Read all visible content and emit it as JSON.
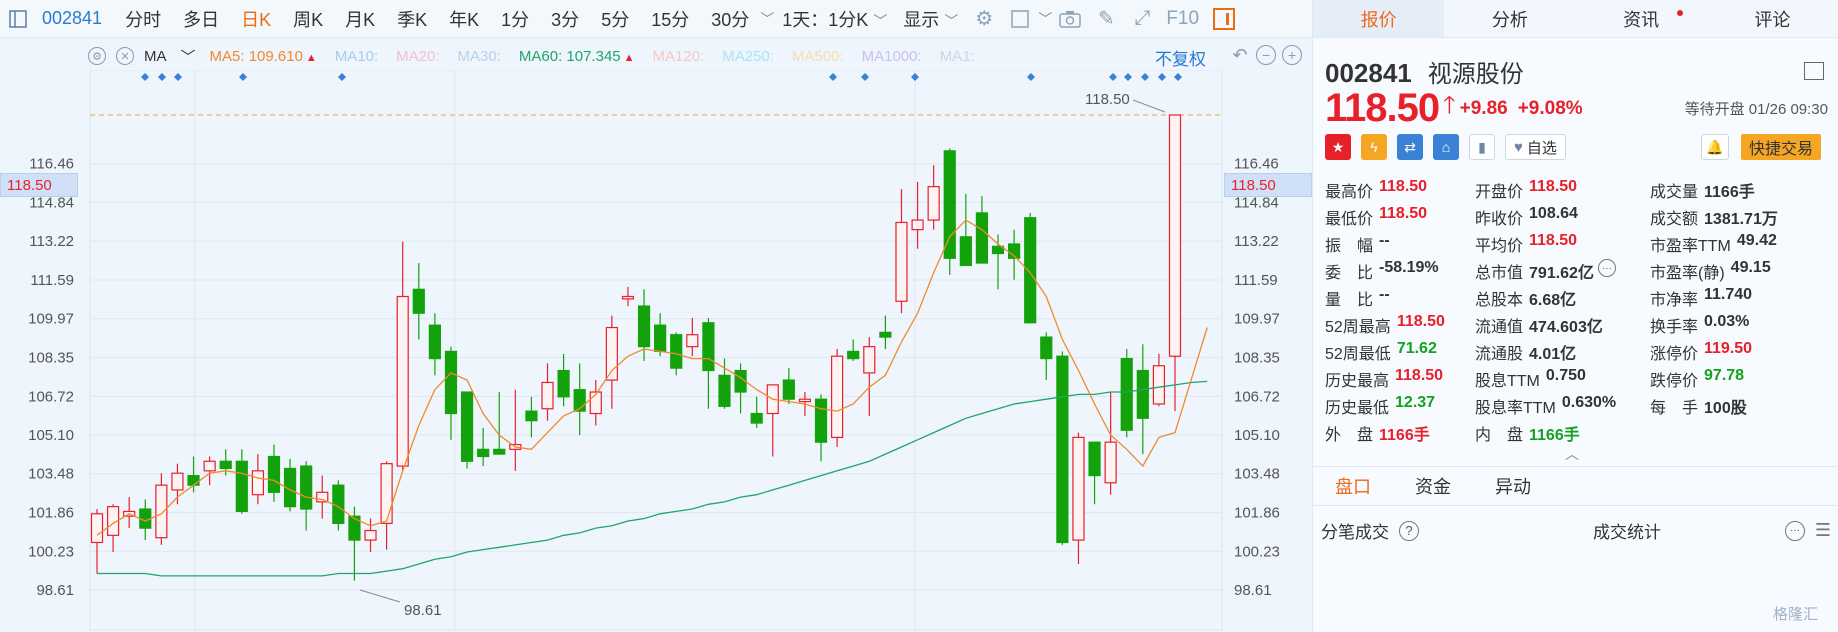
{
  "toolbar": {
    "stock_code": "002841",
    "periods": [
      "分时",
      "多日",
      "日K",
      "周K",
      "月K",
      "季K",
      "年K",
      "1分",
      "3分",
      "5分",
      "15分",
      "30分"
    ],
    "active_period": "日K",
    "range_select": "1天：1分K",
    "display_select": "显示",
    "f10_label": "F10"
  },
  "ma_bar": {
    "selector": "MA",
    "items": [
      {
        "label": "MA5: 109.610",
        "color": "#f08a2c",
        "arrow": true
      },
      {
        "label": "MA10:",
        "color": "#a9cde9"
      },
      {
        "label": "MA20:",
        "color": "#f2bfd6"
      },
      {
        "label": "MA30:",
        "color": "#b9d2ea"
      },
      {
        "label": "MA60: 107.345",
        "color": "#21a56b",
        "arrow": true
      },
      {
        "label": "MA120:",
        "color": "#f7c9c4"
      },
      {
        "label": "MA250:",
        "color": "#a8e6f3"
      },
      {
        "label": "MA500:",
        "color": "#f8dcb0"
      },
      {
        "label": "MA1000:",
        "color": "#c9c2ea"
      },
      {
        "label": "MA1:",
        "color": "#c9d6e4"
      }
    ],
    "adjust_label": "不复权"
  },
  "chart_data": {
    "type": "candlestick",
    "yticks": [
      "116.46",
      "114.84",
      "113.22",
      "111.59",
      "109.97",
      "108.35",
      "106.72",
      "105.10",
      "103.48",
      "101.86",
      "100.23",
      "98.61"
    ],
    "ylim": [
      98.61,
      118.5
    ],
    "current_price_label": "118.50",
    "high_label": "118.50",
    "low_label": "98.61",
    "up_color": "#e8202a",
    "down_color": "#13a20c",
    "ma5_color": "#f08a2c",
    "ma60_color": "#21a56b",
    "candles": [
      {
        "o": 100.6,
        "h": 102.0,
        "l": 99.3,
        "c": 101.8
      },
      {
        "o": 100.9,
        "h": 102.2,
        "l": 100.2,
        "c": 102.1
      },
      {
        "o": 101.7,
        "h": 102.5,
        "l": 101.2,
        "c": 101.9
      },
      {
        "o": 102.0,
        "h": 102.4,
        "l": 100.7,
        "c": 101.2
      },
      {
        "o": 100.8,
        "h": 103.5,
        "l": 100.5,
        "c": 103.0
      },
      {
        "o": 102.8,
        "h": 103.9,
        "l": 102.2,
        "c": 103.5
      },
      {
        "o": 103.4,
        "h": 104.2,
        "l": 102.7,
        "c": 103.0
      },
      {
        "o": 103.6,
        "h": 104.2,
        "l": 103.0,
        "c": 104.0
      },
      {
        "o": 104.0,
        "h": 104.5,
        "l": 103.4,
        "c": 103.7
      },
      {
        "o": 104.0,
        "h": 104.5,
        "l": 101.8,
        "c": 101.9
      },
      {
        "o": 102.6,
        "h": 104.3,
        "l": 102.2,
        "c": 103.6
      },
      {
        "o": 104.2,
        "h": 104.7,
        "l": 102.3,
        "c": 102.7
      },
      {
        "o": 103.7,
        "h": 104.1,
        "l": 101.9,
        "c": 102.1
      },
      {
        "o": 103.8,
        "h": 104.0,
        "l": 101.1,
        "c": 102.0
      },
      {
        "o": 102.3,
        "h": 103.4,
        "l": 101.6,
        "c": 102.7
      },
      {
        "o": 103.0,
        "h": 103.2,
        "l": 101.1,
        "c": 101.4
      },
      {
        "o": 101.7,
        "h": 102.1,
        "l": 99.0,
        "c": 100.7
      },
      {
        "o": 100.7,
        "h": 101.6,
        "l": 100.2,
        "c": 101.1
      },
      {
        "o": 101.4,
        "h": 104.0,
        "l": 100.3,
        "c": 103.9
      },
      {
        "o": 103.8,
        "h": 113.2,
        "l": 103.6,
        "c": 110.9
      },
      {
        "o": 111.2,
        "h": 112.3,
        "l": 109.1,
        "c": 110.2
      },
      {
        "o": 109.7,
        "h": 110.2,
        "l": 107.6,
        "c": 108.3
      },
      {
        "o": 108.6,
        "h": 108.8,
        "l": 104.9,
        "c": 106.0
      },
      {
        "o": 106.9,
        "h": 106.9,
        "l": 103.7,
        "c": 104.0
      },
      {
        "o": 104.5,
        "h": 105.4,
        "l": 103.8,
        "c": 104.2
      },
      {
        "o": 104.5,
        "h": 106.9,
        "l": 104.3,
        "c": 104.3
      },
      {
        "o": 104.5,
        "h": 107.0,
        "l": 103.6,
        "c": 104.7
      },
      {
        "o": 106.1,
        "h": 106.7,
        "l": 105.0,
        "c": 105.7
      },
      {
        "o": 106.2,
        "h": 108.1,
        "l": 105.7,
        "c": 107.3
      },
      {
        "o": 107.8,
        "h": 108.5,
        "l": 106.3,
        "c": 106.7
      },
      {
        "o": 107.0,
        "h": 108.1,
        "l": 105.1,
        "c": 106.1
      },
      {
        "o": 106.0,
        "h": 107.4,
        "l": 105.5,
        "c": 106.9
      },
      {
        "o": 107.4,
        "h": 110.1,
        "l": 106.2,
        "c": 109.6
      },
      {
        "o": 110.8,
        "h": 111.3,
        "l": 110.5,
        "c": 110.9
      },
      {
        "o": 110.5,
        "h": 111.2,
        "l": 108.2,
        "c": 108.8
      },
      {
        "o": 109.7,
        "h": 110.2,
        "l": 108.4,
        "c": 108.6
      },
      {
        "o": 109.3,
        "h": 109.4,
        "l": 107.6,
        "c": 107.9
      },
      {
        "o": 108.8,
        "h": 110.0,
        "l": 108.4,
        "c": 109.3
      },
      {
        "o": 109.8,
        "h": 110.0,
        "l": 106.2,
        "c": 107.8
      },
      {
        "o": 107.6,
        "h": 108.3,
        "l": 106.2,
        "c": 106.3
      },
      {
        "o": 107.8,
        "h": 108.1,
        "l": 106.0,
        "c": 106.9
      },
      {
        "o": 106.0,
        "h": 106.7,
        "l": 105.4,
        "c": 105.6
      },
      {
        "o": 106.0,
        "h": 106.7,
        "l": 104.2,
        "c": 107.2
      },
      {
        "o": 107.4,
        "h": 107.9,
        "l": 106.4,
        "c": 106.6
      },
      {
        "o": 106.5,
        "h": 106.9,
        "l": 105.9,
        "c": 106.6
      },
      {
        "o": 106.6,
        "h": 106.8,
        "l": 104.0,
        "c": 104.8
      },
      {
        "o": 105.0,
        "h": 108.7,
        "l": 104.6,
        "c": 108.4
      },
      {
        "o": 108.6,
        "h": 109.1,
        "l": 108.2,
        "c": 108.3
      },
      {
        "o": 107.7,
        "h": 109.2,
        "l": 105.9,
        "c": 108.8
      },
      {
        "o": 109.4,
        "h": 110.1,
        "l": 108.7,
        "c": 109.2
      },
      {
        "o": 110.7,
        "h": 115.4,
        "l": 110.2,
        "c": 114.0
      },
      {
        "o": 113.7,
        "h": 115.7,
        "l": 112.9,
        "c": 114.1
      },
      {
        "o": 114.1,
        "h": 116.4,
        "l": 113.7,
        "c": 115.5
      },
      {
        "o": 117.0,
        "h": 117.1,
        "l": 111.8,
        "c": 112.5
      },
      {
        "o": 113.4,
        "h": 115.2,
        "l": 112.2,
        "c": 112.2
      },
      {
        "o": 114.4,
        "h": 115.1,
        "l": 112.3,
        "c": 112.3
      },
      {
        "o": 113.0,
        "h": 113.5,
        "l": 111.2,
        "c": 112.7
      },
      {
        "o": 113.1,
        "h": 113.7,
        "l": 111.6,
        "c": 112.5
      },
      {
        "o": 114.2,
        "h": 114.4,
        "l": 109.9,
        "c": 109.8
      },
      {
        "o": 109.2,
        "h": 109.4,
        "l": 107.4,
        "c": 108.3
      },
      {
        "o": 108.4,
        "h": 108.6,
        "l": 100.5,
        "c": 100.6
      },
      {
        "o": 100.7,
        "h": 105.2,
        "l": 99.7,
        "c": 105.0
      },
      {
        "o": 104.8,
        "h": 104.8,
        "l": 102.2,
        "c": 103.4
      },
      {
        "o": 103.1,
        "h": 106.9,
        "l": 102.6,
        "c": 104.8
      },
      {
        "o": 108.3,
        "h": 108.7,
        "l": 105.0,
        "c": 105.3
      },
      {
        "o": 107.8,
        "h": 108.9,
        "l": 104.3,
        "c": 105.8
      },
      {
        "o": 106.4,
        "h": 108.5,
        "l": 106.3,
        "c": 108.0
      },
      {
        "o": 108.4,
        "h": 109.0,
        "l": 106.1,
        "c": 118.5
      }
    ],
    "ma5": [
      100.9,
      101.4,
      101.8,
      101.5,
      101.8,
      102.5,
      103.0,
      103.5,
      103.6,
      103.5,
      103.3,
      103.2,
      102.8,
      102.5,
      102.4,
      102.1,
      101.6,
      101.3,
      101.5,
      103.6,
      105.5,
      107.0,
      107.7,
      107.4,
      106.0,
      105.1,
      104.6,
      104.5,
      105.2,
      105.9,
      106.2,
      106.8,
      107.8,
      108.4,
      108.7,
      108.6,
      108.5,
      108.3,
      108.3,
      107.9,
      107.5,
      107.0,
      106.6,
      106.5,
      106.4,
      106.2,
      106.1,
      106.4,
      107.1,
      107.6,
      109.0,
      110.2,
      111.9,
      113.4,
      114.1,
      113.7,
      113.1,
      112.6,
      111.9,
      110.9,
      109.1,
      107.8,
      106.4,
      105.1,
      104.5,
      103.8,
      105.0,
      105.2,
      107.4,
      109.6
    ],
    "ma60": [
      99.3,
      99.3,
      99.3,
      99.3,
      99.2,
      99.2,
      99.2,
      99.2,
      99.2,
      99.2,
      99.2,
      99.2,
      99.2,
      99.2,
      99.2,
      99.3,
      99.3,
      99.3,
      99.4,
      99.5,
      99.7,
      99.9,
      100.0,
      100.2,
      100.3,
      100.4,
      100.5,
      100.6,
      100.7,
      100.9,
      101.0,
      101.2,
      101.3,
      101.5,
      101.6,
      101.8,
      101.9,
      102.0,
      102.2,
      102.3,
      102.5,
      102.6,
      102.8,
      103.0,
      103.2,
      103.4,
      103.6,
      103.8,
      104.0,
      104.3,
      104.6,
      104.9,
      105.2,
      105.5,
      105.8,
      106.0,
      106.2,
      106.4,
      106.5,
      106.6,
      106.7,
      106.8,
      106.8,
      106.9,
      106.9,
      107.0,
      107.1,
      107.2,
      107.3,
      107.345
    ]
  },
  "panel": {
    "tabs": [
      {
        "label": "报价",
        "active": true
      },
      {
        "label": "分析"
      },
      {
        "label": "资讯",
        "dot": true
      },
      {
        "label": "评论"
      }
    ],
    "code": "002841",
    "name": "视源股份",
    "price": "118.50",
    "change": "+9.86",
    "change_pct": "+9.08%",
    "status": "等待开盘 01/26 09:30",
    "zixuan_label": "自选",
    "quick_trade": "快捷交易",
    "stats": [
      [
        {
          "k": "最高价",
          "v": "118.50",
          "c": "red"
        },
        {
          "k": "开盘价",
          "v": "118.50",
          "c": "red"
        },
        {
          "k": "成交量",
          "v": "1166手",
          "c": "dark"
        }
      ],
      [
        {
          "k": "最低价",
          "v": "118.50",
          "c": "red"
        },
        {
          "k": "昨收价",
          "v": "108.64",
          "c": "dark"
        },
        {
          "k": "成交额",
          "v": "1381.71万",
          "c": "dark"
        }
      ],
      [
        {
          "k": "振　幅",
          "v": "--",
          "c": "dark"
        },
        {
          "k": "平均价",
          "v": "118.50",
          "c": "red"
        },
        {
          "k": "市盈率TTM",
          "v": "49.42",
          "c": "dark"
        }
      ],
      [
        {
          "k": "委　比",
          "v": "-58.19%",
          "c": "dark"
        },
        {
          "k": "总市值",
          "v": "791.62亿",
          "c": "dark",
          "more": true
        },
        {
          "k": "市盈率(静)",
          "v": "49.15",
          "c": "dark"
        }
      ],
      [
        {
          "k": "量　比",
          "v": "--",
          "c": "dark"
        },
        {
          "k": "总股本",
          "v": "6.68亿",
          "c": "dark"
        },
        {
          "k": "市净率",
          "v": "11.740",
          "c": "dark"
        }
      ],
      [
        {
          "k": "52周最高",
          "v": "118.50",
          "c": "red"
        },
        {
          "k": "流通值",
          "v": "474.603亿",
          "c": "dark"
        },
        {
          "k": "换手率",
          "v": "0.03%",
          "c": "dark"
        }
      ],
      [
        {
          "k": "52周最低",
          "v": "71.62",
          "c": "green"
        },
        {
          "k": "流通股",
          "v": "4.01亿",
          "c": "dark"
        },
        {
          "k": "涨停价",
          "v": "119.50",
          "c": "red"
        }
      ],
      [
        {
          "k": "历史最高",
          "v": "118.50",
          "c": "red"
        },
        {
          "k": "股息TTM",
          "v": "0.750",
          "c": "dark"
        },
        {
          "k": "跌停价",
          "v": "97.78",
          "c": "green"
        }
      ],
      [
        {
          "k": "历史最低",
          "v": "12.37",
          "c": "green"
        },
        {
          "k": "股息率TTM",
          "v": "0.630%",
          "c": "dark"
        },
        {
          "k": "每　手",
          "v": "100股",
          "c": "dark"
        }
      ],
      [
        {
          "k": "外　盘",
          "v": "1166手",
          "c": "red"
        },
        {
          "k": "内　盘",
          "v": "1166手",
          "c": "green"
        },
        {
          "k": "",
          "v": "",
          "c": "dark"
        }
      ]
    ],
    "sub_tabs": [
      "盘口",
      "资金",
      "异动"
    ],
    "trade_label": "分笔成交",
    "trade_stats_label": "成交统计",
    "watermark": "格隆汇"
  }
}
